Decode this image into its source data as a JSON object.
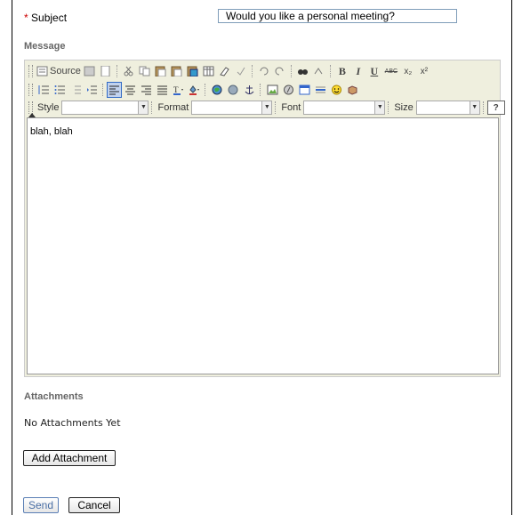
{
  "subject": {
    "required_mark": "*",
    "label": "Subject",
    "value": "Would you like a personal meeting?"
  },
  "message": {
    "title": "Message",
    "toolbar": {
      "source_label": "Source",
      "bold": "B",
      "italic": "I",
      "underline": "U",
      "strike": "ABC",
      "subscript": "x₂",
      "superscript": "x²",
      "style_label": "Style",
      "format_label": "Format",
      "font_label": "Font",
      "size_label": "Size",
      "help": "?"
    },
    "body_text": "blah, blah"
  },
  "attachments": {
    "title": "Attachments",
    "empty_text": "No Attachments Yet",
    "add_button": "Add Attachment"
  },
  "actions": {
    "send": "Send",
    "cancel": "Cancel"
  },
  "colors": {
    "required": "#cc0000",
    "send_text": "#4a6fa5",
    "editor_bg": "#efefde",
    "active_btn": "#c1d2ee"
  }
}
